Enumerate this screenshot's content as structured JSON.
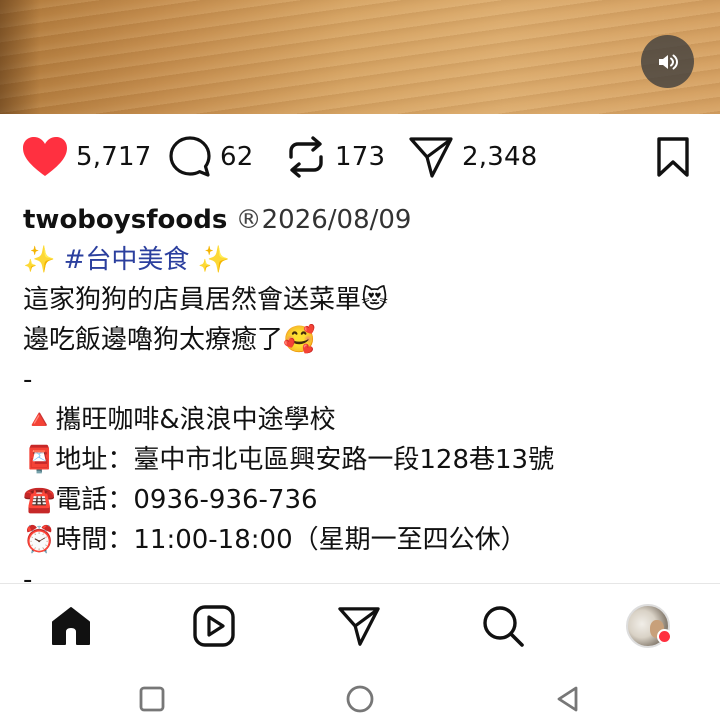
{
  "post": {
    "likes": "5,717",
    "comments": "62",
    "reposts": "173",
    "shares": "2,348"
  },
  "caption": {
    "username": "twoboysfoods",
    "registered_mark": "®",
    "date": "2026/08/09",
    "line_hashtag_pre": "✨ ",
    "hashtag": "#台中美食",
    "line_hashtag_post": " ✨",
    "line1": "這家狗狗的店員居然會送菜單😻",
    "line2": "邊吃飯邊嚕狗太療癒了🥰",
    "sep1": "-",
    "store_icon": "🔺",
    "store": "攜旺咖啡&浪浪中途學校",
    "address_icon": "📮",
    "address": "地址：臺中市北屯區興安路一段128巷13號",
    "phone_icon": "☎️",
    "phone": "電話：0936-936-736",
    "hours_icon": "⏰",
    "hours": "時間：11:00-18:00（星期一至四公休）",
    "sep2": "-"
  },
  "colors": {
    "like_red": "#ff3040",
    "hashtag_blue": "#2b3f9e",
    "notification_dot": "#ff3040"
  },
  "icons": {
    "mute": "speaker-icon",
    "like": "heart-icon",
    "comment": "comment-icon",
    "repost": "repost-icon",
    "share": "send-icon",
    "save": "bookmark-icon",
    "home": "home-icon",
    "reels": "reels-icon",
    "messages": "send-icon",
    "search": "search-icon",
    "profile": "avatar",
    "recents": "square-icon",
    "home_sys": "circle-icon",
    "back": "triangle-back-icon"
  }
}
